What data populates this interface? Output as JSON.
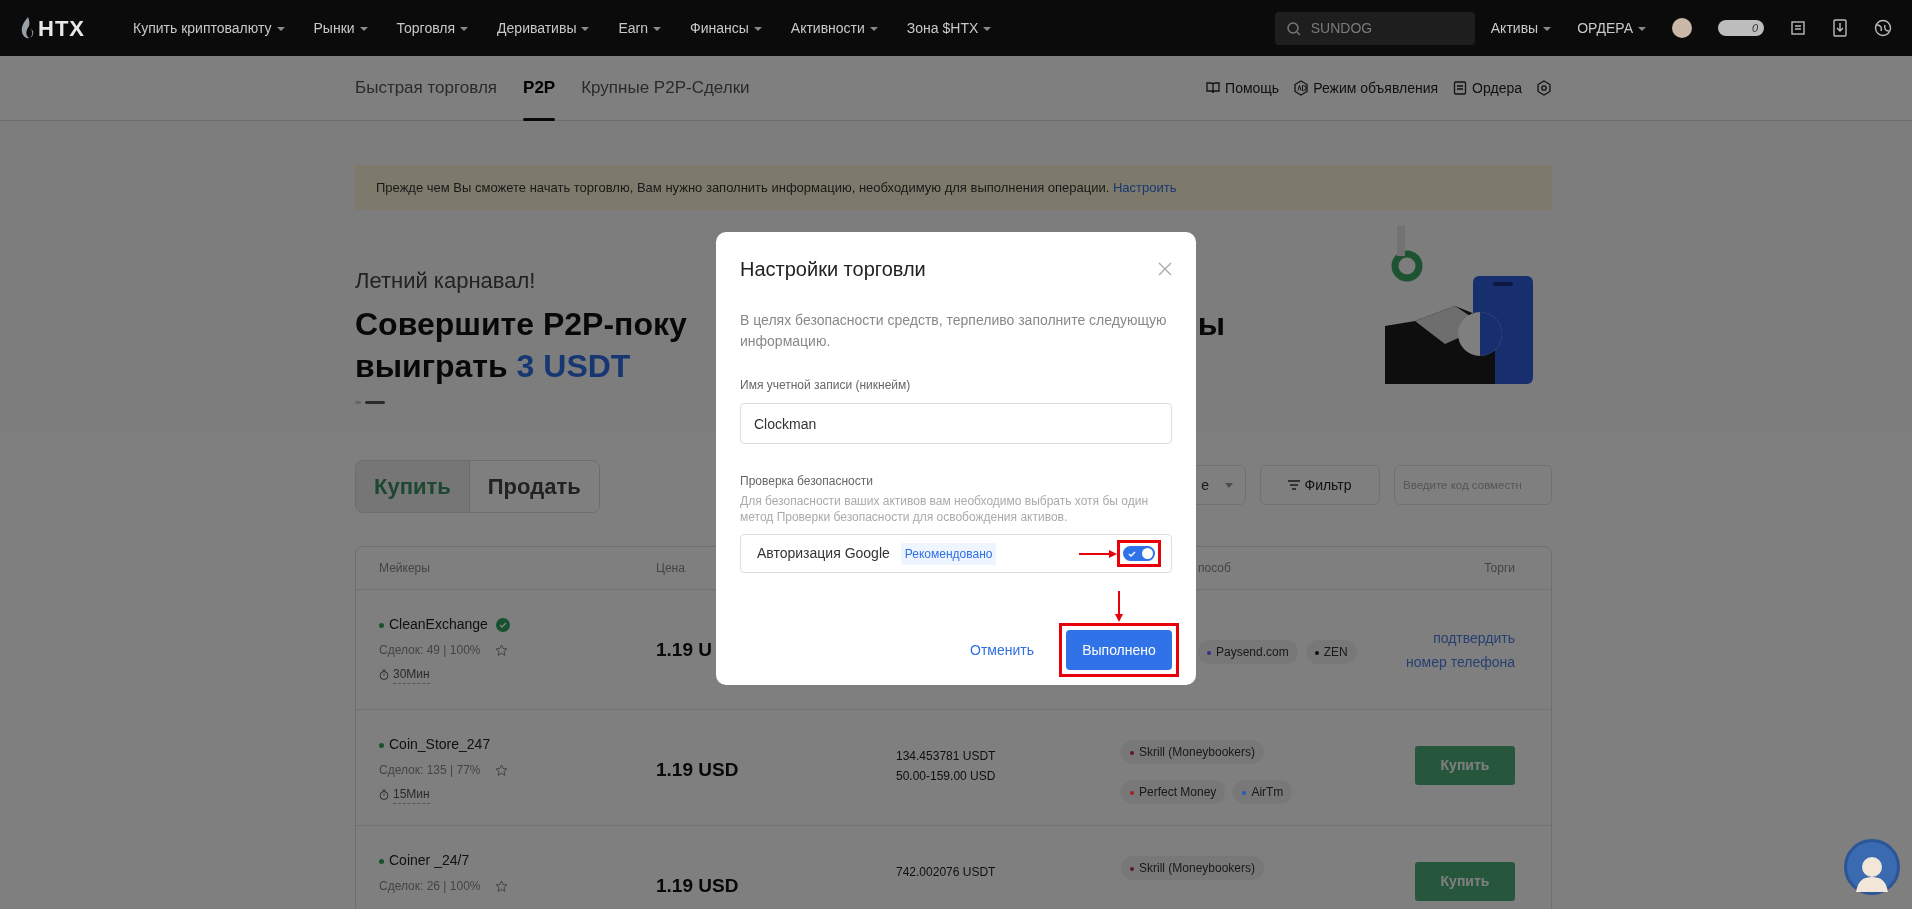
{
  "top_nav": {
    "logo": "HTX",
    "menu": [
      "Купить криптовалюту",
      "Рынки",
      "Торговля",
      "Деривативы",
      "Earn",
      "Финансы",
      "Активности",
      "Зона $HTX"
    ],
    "search": {
      "placeholder": "SUNDOG"
    },
    "right_menu": [
      "Активы",
      "ОРДЕРА"
    ],
    "points_count": "0"
  },
  "sub_nav": {
    "tabs": [
      {
        "label": "Быстрая торговля",
        "selected": false
      },
      {
        "label": "P2P",
        "selected": true
      },
      {
        "label": "Крупные P2P-Сделки",
        "selected": false
      }
    ],
    "links": [
      {
        "label": "Помощь",
        "kind": "help"
      },
      {
        "label": "Режим объявления",
        "kind": "ad"
      },
      {
        "label": "Ордера",
        "kind": "orders"
      }
    ]
  },
  "notice": {
    "text": "Прежде чем Вы сможете начать торговлю, Вам нужно заполнить информацию, необходимую для выполнения операции.",
    "link": "Настроить"
  },
  "banner": {
    "kicker": "Летний карнавал!",
    "headline_start": "Совершите P2P-поку",
    "headline_end": "ы",
    "line2": "выиграть",
    "highlight": "3 USDT",
    "slides": [
      {
        "selected": false
      },
      {
        "selected": true
      }
    ]
  },
  "trade_toggle": [
    {
      "label": "Купить",
      "selected": true
    },
    {
      "label": "Продать",
      "selected": false
    }
  ],
  "filters": {
    "select_value": "е",
    "filter_button": "Фильтр",
    "code_placeholder": "Введите код совместн"
  },
  "table": {
    "columns": [
      "Мейкеры",
      "Цена",
      "пособ",
      "Торги"
    ],
    "rows": [
      {
        "maker": "CleanExchange",
        "verified": true,
        "stats": "Сделок: 49 | 100%",
        "time": "30Мин",
        "price": "1.19 U",
        "amounts": [],
        "payments": [
          {
            "name": "Paysend.com",
            "color": "#3c2c8c"
          },
          {
            "name": "ZEN",
            "color": "#111111"
          }
        ],
        "action": {
          "kind": "link",
          "label": "подтвердить номер телефона"
        }
      },
      {
        "maker": "Coin_Store_247",
        "verified": false,
        "stats": "Сделок: 135 | 77%",
        "time": "15Мин",
        "price": "1.19 USD",
        "amounts": [
          "134.453781 USDT",
          "50.00-159.00 USD"
        ],
        "payments": [
          {
            "name": "Skrill (Moneybookers)",
            "color": "#5a1638"
          },
          {
            "name": "Perfect Money",
            "color": "#a0241a"
          },
          {
            "name": "AirTm",
            "color": "#2a5cb8"
          }
        ],
        "action": {
          "kind": "button",
          "label": "Купить"
        }
      },
      {
        "maker": "Coiner _24/7",
        "verified": false,
        "stats": "Сделок: 26 | 100%",
        "price": "1.19 USD",
        "amounts": [
          "742.002076 USDT"
        ],
        "payments": [
          {
            "name": "Skrill (Moneybookers)",
            "color": "#5a1638"
          }
        ],
        "action": {
          "kind": "button",
          "label": "Купить"
        }
      }
    ]
  },
  "modal": {
    "title": "Настройки торговли",
    "intro": "В целях безопасности средств, терпеливо заполните следующую информацию.",
    "nickname": {
      "label": "Имя учетной записи (никнейм)",
      "value": "Clockman"
    },
    "security": {
      "label": "Проверка безопасности",
      "hint": "Для безопасности ваших активов вам необходимо выбрать хотя бы один метод Проверки безопасности для освобождения активов.",
      "methods": [
        {
          "name": "Авторизация Google",
          "tag": "Рекомендовано",
          "on": true
        }
      ]
    },
    "buttons": [
      {
        "label": "Отменить",
        "kind": "link"
      },
      {
        "label": "Выполнено",
        "kind": "primary"
      }
    ]
  }
}
